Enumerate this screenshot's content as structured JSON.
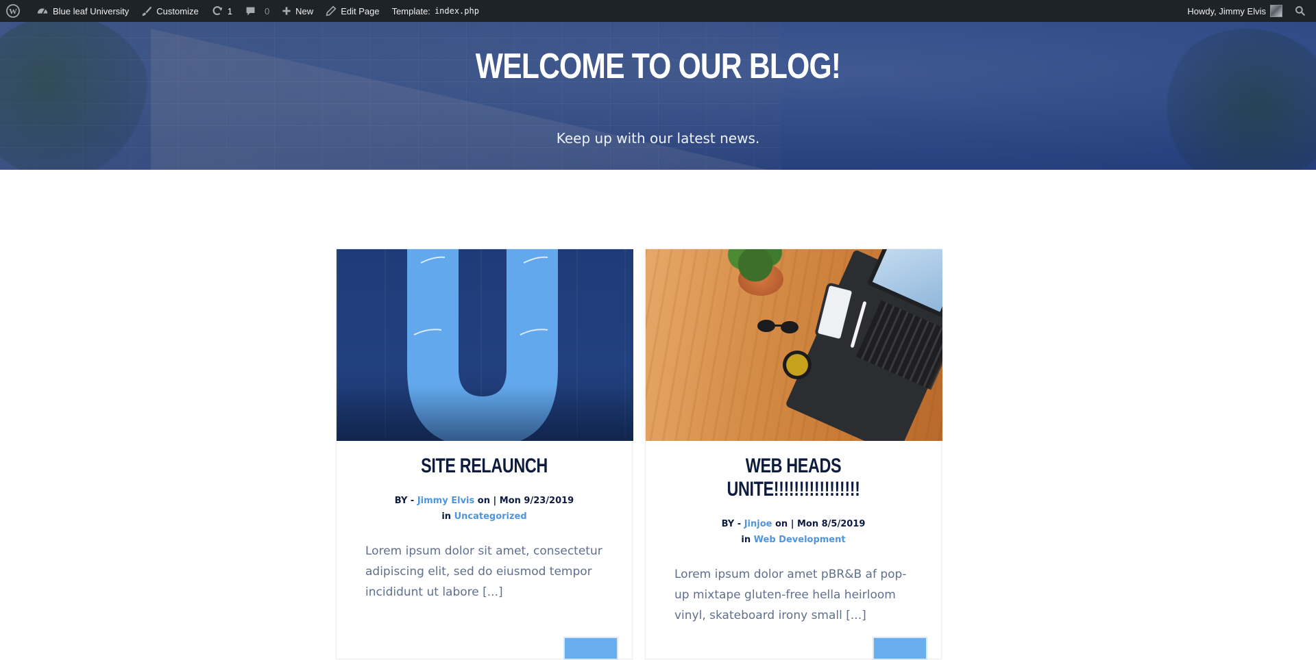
{
  "adminbar": {
    "site_name": "Blue leaf University",
    "customize": "Customize",
    "updates_count": "1",
    "comments_count": "0",
    "new": "New",
    "edit_page": "Edit Page",
    "template_label": "Template:",
    "template_file": "index.php",
    "howdy": "Howdy, Jimmy Elvis"
  },
  "hero": {
    "title": "WELCOME TO OUR BLOG!",
    "subtitle": "Keep up with our latest news."
  },
  "posts": [
    {
      "title": "SITE RELAUNCH",
      "by_label": "BY -",
      "author": "Jimmy Elvis",
      "date_text": "on | Mon 9/23/2019",
      "in_label": "in",
      "category": "Uncategorized",
      "excerpt": "Lorem ipsum dolor sit amet, consectetur adipiscing elit, sed do eiusmod tempor incididunt ut labore [...]"
    },
    {
      "title": "WEB HEADS UNITE!!!!!!!!!!!!!!!!!",
      "by_label": "BY -",
      "author": "Jinjoe",
      "date_text": "on | Mon 8/5/2019",
      "in_label": "in",
      "category": "Web Development",
      "excerpt": "Lorem ipsum dolor amet pBR&B af pop-up mixtape gluten-free hella heirloom vinyl, skateboard irony small [...]"
    }
  ],
  "colors": {
    "adminbar_bg": "#1d2327",
    "hero_overlay": "#264282",
    "title_navy": "#0d1b3e",
    "link_blue": "#4f95dc",
    "excerpt_gray": "#5f6f8e",
    "button_blue": "#6aaef0"
  },
  "icons": [
    "wordpress-icon",
    "dashboard-icon",
    "brush-icon",
    "updates-icon",
    "comment-icon",
    "plus-icon",
    "pencil-icon",
    "search-icon"
  ]
}
